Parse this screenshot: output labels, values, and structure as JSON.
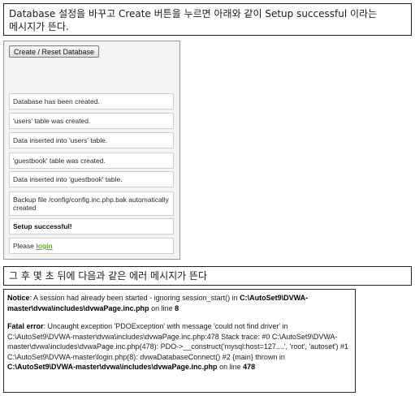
{
  "captions": {
    "top_line1": "Database 설정을 바꾸고 Create 버튼을 누르면 아래와 같이 Setup successful 이라는",
    "top_line2": "메시지가 뜬다.",
    "middle": "그 후 몇 초 뒤에 다음과 같은 에러 메시지가 뜬다"
  },
  "setup_panel": {
    "button_label": "Create / Reset Database",
    "messages": [
      "Database has been created.",
      "'users' table was created.",
      "Data inserted into 'users' table.",
      "'guestbook' table was created.",
      "Data inserted into 'guestbook' table.",
      "Backup file /config/config.inc.php.bak automatically created",
      "Setup successful!"
    ],
    "login_prefix": "Please ",
    "login_link": "login"
  },
  "errors": {
    "notice_label": "Notice",
    "notice_text": ": A session had already been started - ignoring session_start() in ",
    "notice_path": "C:\\AutoSet9\\DVWA-master\\dvwa\\includes\\dvwaPage.inc.php",
    "notice_online": " on line ",
    "notice_line": "8",
    "fatal_label": "Fatal error",
    "fatal_text": ": Uncaught exception 'PDOException' with message 'could not find driver' in C:\\AutoSet9\\DVWA-master\\dvwa\\includes\\dvwaPage.inc.php:478 Stack trace: #0 C:\\AutoSet9\\DVWA-master\\dvwa\\includes\\dvwaPage.inc.php(478): PDO->__construct('mysql:host=127....', 'root', 'autoset') #1 C:\\AutoSet9\\DVWA-master\\login.php(8): dvwaDatabaseConnect() #2 {main} thrown in ",
    "fatal_path": "C:\\AutoSet9\\DVWA-master\\dvwa\\includes\\dvwaPage.inc.php",
    "fatal_online": " on line ",
    "fatal_line": "478"
  }
}
